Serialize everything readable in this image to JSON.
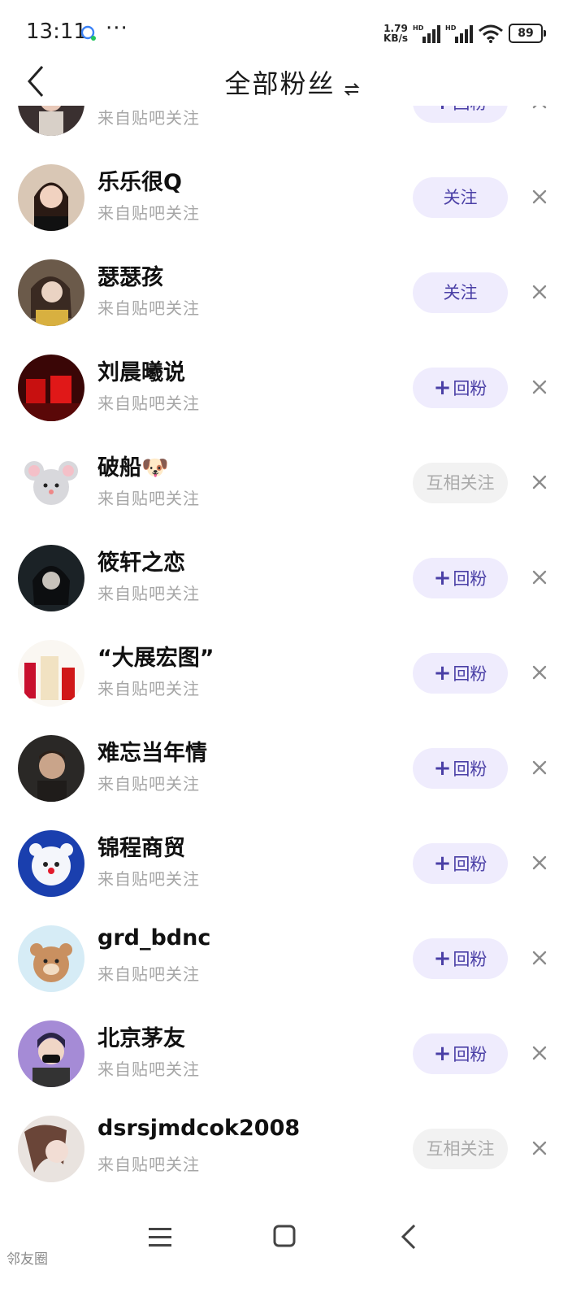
{
  "status_bar": {
    "time": "13:11",
    "more": "···",
    "net_speed_value": "1.79",
    "net_speed_unit": "KB/s",
    "battery": "89"
  },
  "header": {
    "title": "全部粉丝"
  },
  "followers": [
    {
      "name": "",
      "source": "来自贴吧关注",
      "button": "回粉",
      "state": "follow-back"
    },
    {
      "name": "乐乐很Q",
      "source": "来自贴吧关注",
      "button": "关注",
      "state": "follow"
    },
    {
      "name": "瑟瑟孩",
      "source": "来自贴吧关注",
      "button": "关注",
      "state": "follow"
    },
    {
      "name": "刘晨曦说",
      "source": "来自贴吧关注",
      "button": "回粉",
      "state": "follow-back"
    },
    {
      "name": "破船🐶",
      "source": "来自贴吧关注",
      "button": "互相关注",
      "state": "mutual"
    },
    {
      "name": "筱轩之恋",
      "source": "来自贴吧关注",
      "button": "回粉",
      "state": "follow-back"
    },
    {
      "name": "“大展宏图”",
      "source": "来自贴吧关注",
      "button": "回粉",
      "state": "follow-back"
    },
    {
      "name": "难忘当年情",
      "source": "来自贴吧关注",
      "button": "回粉",
      "state": "follow-back"
    },
    {
      "name": "锦程商贸",
      "source": "来自贴吧关注",
      "button": "回粉",
      "state": "follow-back"
    },
    {
      "name": "grd_bdnc",
      "source": "来自贴吧关注",
      "button": "回粉",
      "state": "follow-back"
    },
    {
      "name": "北京茅友",
      "source": "来自贴吧关注",
      "button": "回粉",
      "state": "follow-back"
    },
    {
      "name": "dsrsjmdcok2008",
      "source": "来自贴吧关注",
      "button": "互相关注",
      "state": "mutual"
    }
  ],
  "watermark": "邻友圈",
  "colors": {
    "accent_text": "#4a3fa6",
    "accent_bg": "#efecfd",
    "muted_bg": "#f2f2f2",
    "muted_text": "#aaaaaa",
    "secondary_text": "#a6a6a6"
  }
}
